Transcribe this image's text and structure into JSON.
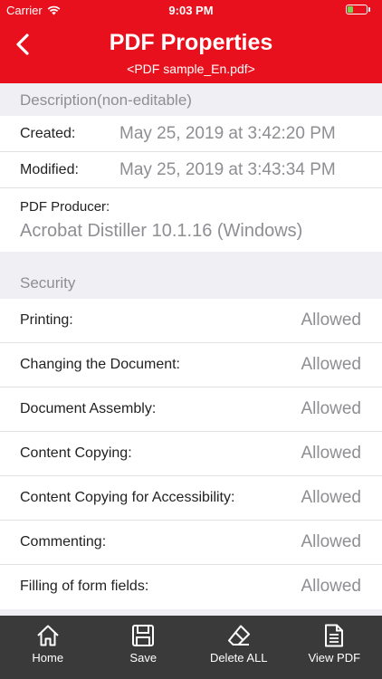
{
  "status": {
    "carrier": "Carrier",
    "time": "9:03 PM"
  },
  "header": {
    "title": "PDF Properties",
    "subtitle": "<PDF sample_En.pdf>",
    "back_icon": "chevron-left-icon"
  },
  "colors": {
    "accent": "#e8101c",
    "toolbar": "#3a3a3a",
    "secondary_text": "#8e8e93"
  },
  "description": {
    "header": "Description(non-editable)",
    "created_label": "Created:",
    "created_value": "May 25, 2019 at 3:42:20 PM",
    "modified_label": "Modified:",
    "modified_value": "May 25, 2019 at 3:43:34 PM",
    "producer_label": "PDF Producer:",
    "producer_value": "Acrobat Distiller 10.1.16 (Windows)"
  },
  "security": {
    "header": "Security",
    "items": [
      {
        "label": "Printing:",
        "value": "Allowed"
      },
      {
        "label": "Changing the Document:",
        "value": "Allowed"
      },
      {
        "label": "Document Assembly:",
        "value": "Allowed"
      },
      {
        "label": "Content Copying:",
        "value": "Allowed"
      },
      {
        "label": "Content Copying for Accessibility:",
        "value": "Allowed"
      },
      {
        "label": "Commenting:",
        "value": "Allowed"
      },
      {
        "label": "Filling of form fields:",
        "value": "Allowed"
      }
    ]
  },
  "toolbar": {
    "home": "Home",
    "home_icon": "home-icon",
    "save": "Save",
    "save_icon": "save-icon",
    "delete_all": "Delete ALL",
    "delete_icon": "eraser-icon",
    "view_pdf": "View PDF",
    "view_icon": "document-icon"
  }
}
